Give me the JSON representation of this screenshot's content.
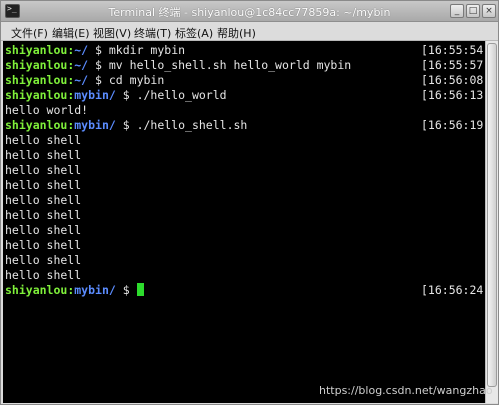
{
  "window": {
    "title": "Terminal 终端 - shiyanlou@1c84cc77859a: ~/mybin",
    "min_label": "_",
    "max_label": "□",
    "close_label": "×"
  },
  "menu": {
    "items": [
      "文件(F)",
      "编辑(E)",
      "视图(V)",
      "终端(T)",
      "标签(A)",
      "帮助(H)"
    ]
  },
  "terminal": {
    "lines": [
      {
        "user": "shiyanlou",
        "path": "~/",
        "cmd": " $ mkdir mybin",
        "time": "[16:55:54]"
      },
      {
        "user": "shiyanlou",
        "path": "~/",
        "cmd": " $ mv hello_shell.sh hello_world mybin",
        "time": "[16:55:57]"
      },
      {
        "user": "shiyanlou",
        "path": "~/",
        "cmd": " $ cd mybin",
        "time": "[16:56:08]"
      },
      {
        "user": "shiyanlou",
        "path": "mybin/",
        "cmd": " $ ./hello_world",
        "time": "[16:56:13]"
      },
      {
        "output": "hello world!"
      },
      {
        "user": "shiyanlou",
        "path": "mybin/",
        "cmd": " $ ./hello_shell.sh",
        "time": "[16:56:19]"
      },
      {
        "output": "hello shell"
      },
      {
        "output": "hello shell"
      },
      {
        "output": "hello shell"
      },
      {
        "output": "hello shell"
      },
      {
        "output": "hello shell"
      },
      {
        "output": "hello shell"
      },
      {
        "output": "hello shell"
      },
      {
        "output": "hello shell"
      },
      {
        "output": "hello shell"
      },
      {
        "output": "hello shell"
      },
      {
        "user": "shiyanlou",
        "path": "mybin/",
        "cmd": " $ ",
        "time": "[16:56:24]",
        "cursor": true
      }
    ]
  },
  "watermark": "https://blog.csdn.net/wangzhao"
}
